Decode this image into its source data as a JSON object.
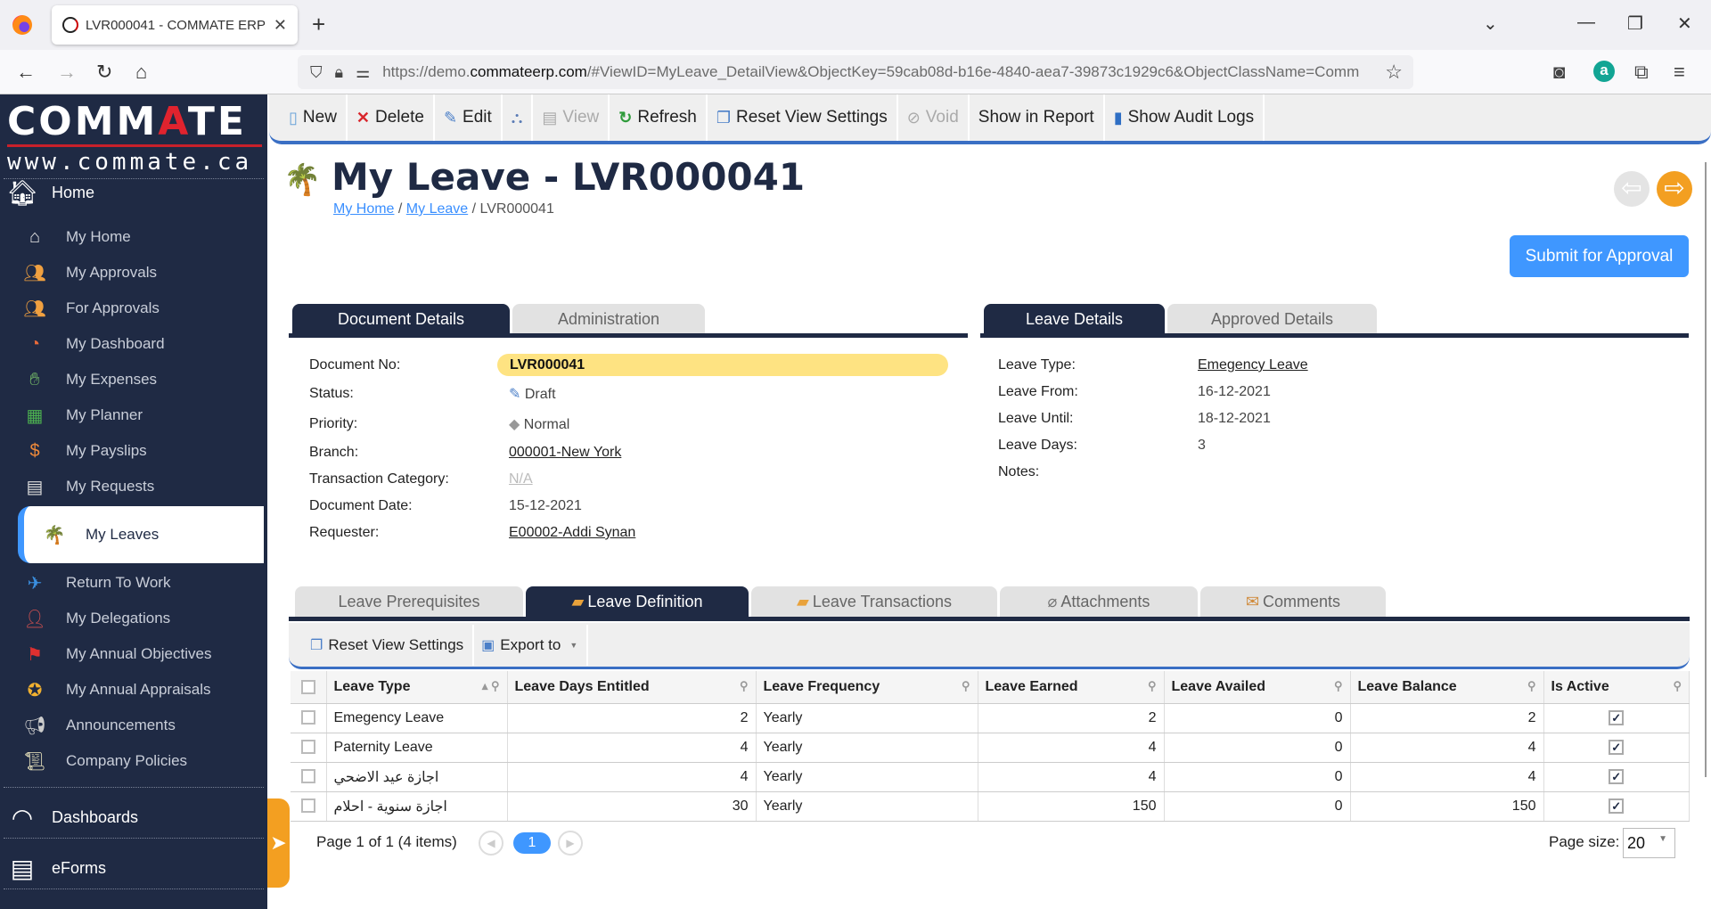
{
  "browser": {
    "tab_title": "LVR000041 - COMMATE ERP",
    "url_prefix": "https://demo.",
    "url_domain": "commateerp.com",
    "url_rest": "/#ViewID=MyLeave_DetailView&ObjectKey=59cab08d-b16e-4840-aea7-39873c1929c6&ObjectClassName=Comm",
    "account_initial": "a"
  },
  "logo": {
    "brand_pre": "COMM",
    "brand_accent": "A",
    "brand_post": "TE",
    "site": "www.commate.ca"
  },
  "sidebar": {
    "home_label": "Home",
    "items": [
      {
        "label": "My Home",
        "icon": "house-icon"
      },
      {
        "label": "My Approvals",
        "icon": "approvals-icon"
      },
      {
        "label": "For Approvals",
        "icon": "approvals-icon"
      },
      {
        "label": "My Dashboard",
        "icon": "gauge-icon"
      },
      {
        "label": "My Expenses",
        "icon": "money-hand-icon"
      },
      {
        "label": "My Planner",
        "icon": "calendar-icon"
      },
      {
        "label": "My Payslips",
        "icon": "payslip-icon"
      },
      {
        "label": "My Requests",
        "icon": "request-doc-icon"
      },
      {
        "label": "My Leaves",
        "icon": "palm-tree-icon",
        "active": true
      },
      {
        "label": "Return To Work",
        "icon": "plane-icon"
      },
      {
        "label": "My Delegations",
        "icon": "people-icon"
      },
      {
        "label": "My Annual Objectives",
        "icon": "target-flag-icon"
      },
      {
        "label": "My Annual Appraisals",
        "icon": "medal-icon"
      },
      {
        "label": "Announcements",
        "icon": "megaphone-icon"
      },
      {
        "label": "Company Policies",
        "icon": "scroll-icon"
      }
    ],
    "dashboards_label": "Dashboards",
    "eforms_label": "eForms"
  },
  "toolbar": {
    "new": "New",
    "delete": "Delete",
    "edit": "Edit",
    "view": "View",
    "refresh": "Refresh",
    "reset_view": "Reset View Settings",
    "void": "Void",
    "show_in_report": "Show in Report",
    "audit_logs": "Show Audit Logs"
  },
  "header": {
    "title": "My Leave - LVR000041",
    "breadcrumb": [
      "My Home",
      "My Leave",
      "LVR000041"
    ],
    "submit": "Submit for Approval"
  },
  "doc_tabs": [
    "Document Details",
    "Administration"
  ],
  "doc_fields": {
    "document_no": {
      "label": "Document No:",
      "value": "LVR000041"
    },
    "status": {
      "label": "Status:",
      "value": "Draft"
    },
    "priority": {
      "label": "Priority:",
      "value": "Normal"
    },
    "branch": {
      "label": "Branch:",
      "value": "000001-New York"
    },
    "transaction_category": {
      "label": "Transaction Category:",
      "value": "N/A"
    },
    "document_date": {
      "label": "Document Date:",
      "value": "15-12-2021"
    },
    "requester": {
      "label": "Requester:",
      "value": "E00002-Addi Synan"
    }
  },
  "leave_tabs": [
    "Leave Details",
    "Approved Details"
  ],
  "leave_fields": {
    "leave_type": {
      "label": "Leave Type:",
      "value": "Emegency Leave"
    },
    "leave_from": {
      "label": "Leave From:",
      "value": "16-12-2021"
    },
    "leave_until": {
      "label": "Leave Until:",
      "value": "18-12-2021"
    },
    "leave_days": {
      "label": "Leave Days:",
      "value": "3"
    },
    "notes": {
      "label": "Notes:",
      "value": ""
    }
  },
  "detail_tabs": [
    "Leave Prerequisites",
    "Leave Definition",
    "Leave Transactions",
    "Attachments",
    "Comments"
  ],
  "grid": {
    "reset_view": "Reset View Settings",
    "export": "Export to",
    "columns": [
      "Leave Type",
      "Leave Days Entitled",
      "Leave Frequency",
      "Leave Earned",
      "Leave Availed",
      "Leave Balance",
      "Is Active"
    ],
    "rows": [
      {
        "type": "Emegency Leave",
        "entitled": "2",
        "frequency": "Yearly",
        "earned": "2",
        "availed": "0",
        "balance": "2",
        "active": true
      },
      {
        "type": "Paternity Leave",
        "entitled": "4",
        "frequency": "Yearly",
        "earned": "4",
        "availed": "0",
        "balance": "4",
        "active": true
      },
      {
        "type": "اجازة عيد الاضحي",
        "entitled": "4",
        "frequency": "Yearly",
        "earned": "4",
        "availed": "0",
        "balance": "4",
        "active": true
      },
      {
        "type": "اجازة سنوية - احلام",
        "entitled": "30",
        "frequency": "Yearly",
        "earned": "150",
        "availed": "0",
        "balance": "150",
        "active": true
      }
    ]
  },
  "pager": {
    "summary": "Page 1 of 1 (4 items)",
    "current_page": "1",
    "page_size_label": "Page size:",
    "page_size": "20"
  },
  "colors": {
    "sidebar": "#1f2a44",
    "accent": "#3f97ff",
    "orange": "#f39f21",
    "highlight": "#fee382"
  }
}
